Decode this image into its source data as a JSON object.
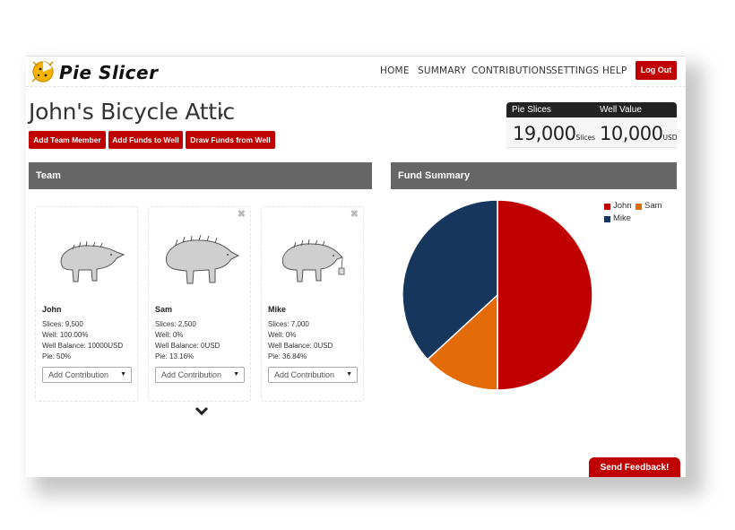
{
  "brand": {
    "name": "Pie Slicer"
  },
  "nav": {
    "home": "HOME",
    "summary": "SUMMARY",
    "contributions": "CONTRIBUTIONS",
    "settings": "SETTINGS",
    "help": "HELP",
    "logout": "Log Out"
  },
  "company": {
    "title": "John's Bicycle Attic"
  },
  "actions": {
    "add_member": "Add Team Member",
    "add_funds": "Add Funds to Well",
    "draw_funds": "Draw Funds from Well"
  },
  "stats": {
    "pie_slices_label": "Pie Slices",
    "well_value_label": "Well Value",
    "pie_slices": "19,000",
    "pie_slices_unit": "Slices",
    "well_value": "10,000",
    "well_value_unit": "USD"
  },
  "team": {
    "heading": "Team",
    "members": [
      {
        "name": "John",
        "slices": "Slices: 9,500",
        "well": "Well: 100.00%",
        "balance": "Well Balance: 10000USD",
        "pie": "Pie: 50%",
        "select": "Add Contribution"
      },
      {
        "name": "Sam",
        "slices": "Slices: 2,500",
        "well": "Well: 0%",
        "balance": "Well Balance: 0USD",
        "pie": "Pie: 13.16%",
        "select": "Add Contribution"
      },
      {
        "name": "Mike",
        "slices": "Slices: 7,000",
        "well": "Well: 0%",
        "balance": "Well Balance: 0USD",
        "pie": "Pie: 36.84%",
        "select": "Add Contribution"
      }
    ]
  },
  "summary": {
    "heading": "Fund Summary"
  },
  "chart_data": {
    "type": "pie",
    "title": "",
    "legend": "top-right",
    "slices": [
      {
        "label": "John",
        "value": 50,
        "color": "#c00000"
      },
      {
        "label": "Sam",
        "value": 13.16,
        "color": "#e36c09"
      },
      {
        "label": "Mike",
        "value": 36.84,
        "color": "#17365d"
      }
    ]
  },
  "feedback": {
    "label": "Send Feedback!"
  },
  "colors": {
    "accent": "#c00000",
    "panel": "#666666",
    "dark": "#222222"
  }
}
